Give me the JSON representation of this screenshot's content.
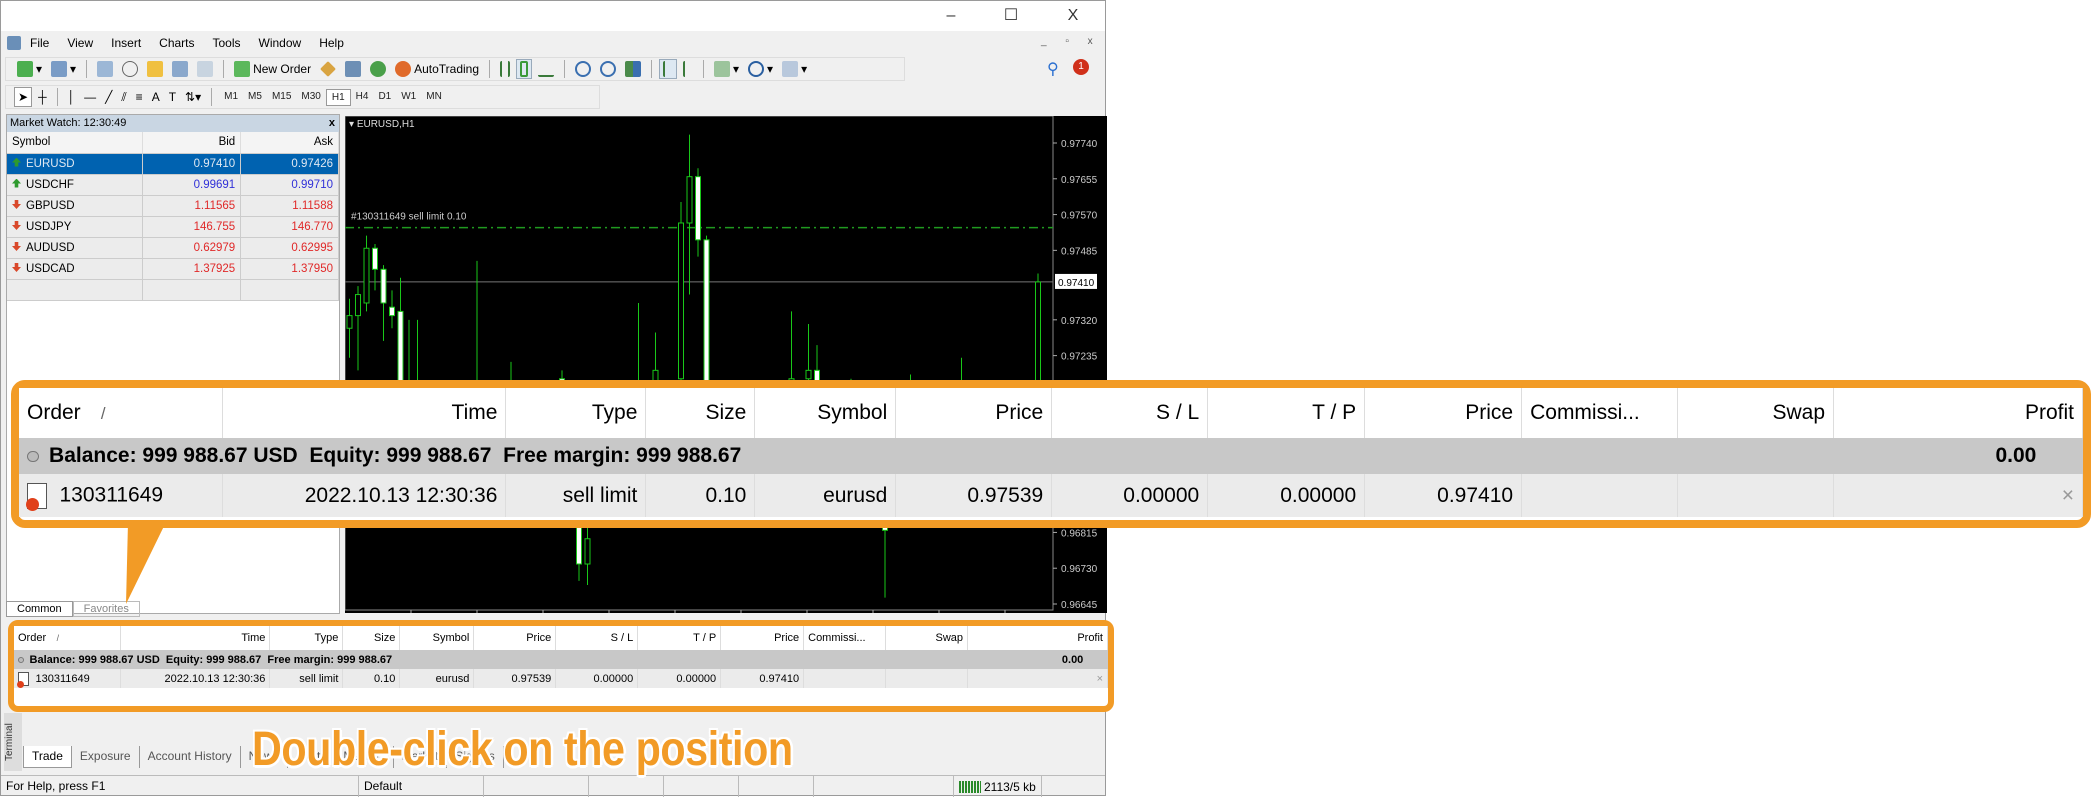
{
  "window": {
    "minimize": "–",
    "maximize": "☐",
    "close": "X"
  },
  "menu": [
    "File",
    "View",
    "Insert",
    "Charts",
    "Tools",
    "Window",
    "Help"
  ],
  "toolbar": {
    "new_order": "New Order",
    "auto_trading": "AutoTrading",
    "notification_count": "1"
  },
  "timeframes": [
    "M1",
    "M5",
    "M15",
    "M30",
    "H1",
    "H4",
    "D1",
    "W1",
    "MN"
  ],
  "active_timeframe": "H1",
  "market_watch": {
    "title": "Market Watch: 12:30:49",
    "close": "x",
    "columns": [
      "Symbol",
      "Bid",
      "Ask"
    ],
    "rows": [
      {
        "symbol": "EURUSD",
        "bid": "0.97410",
        "ask": "0.97426",
        "dir": "up",
        "color": "#dfe8f2",
        "selected": true
      },
      {
        "symbol": "USDCHF",
        "bid": "0.99691",
        "ask": "0.99710",
        "dir": "up",
        "color": "#3030d8"
      },
      {
        "symbol": "GBPUSD",
        "bid": "1.11565",
        "ask": "1.11588",
        "dir": "down",
        "color": "#e02828"
      },
      {
        "symbol": "USDJPY",
        "bid": "146.755",
        "ask": "146.770",
        "dir": "down",
        "color": "#e02828"
      },
      {
        "symbol": "AUDUSD",
        "bid": "0.62979",
        "ask": "0.62995",
        "dir": "down",
        "color": "#e02828"
      },
      {
        "symbol": "USDCAD",
        "bid": "1.37925",
        "ask": "1.37950",
        "dir": "down",
        "color": "#e02828"
      }
    ],
    "tabs": [
      "Common",
      "Favorites"
    ]
  },
  "chart": {
    "title": "EURUSD,H1",
    "order_line_label": "#130311649 sell limit 0.10",
    "order_line_price": 0.97539,
    "bid_price": 0.9741,
    "bid_label": "0.97410",
    "price_ticks": [
      "0.97740",
      "0.97655",
      "0.97570",
      "0.97485",
      "0.97320",
      "0.97235",
      "0.96815",
      "0.96730",
      "0.96645"
    ],
    "price_range": [
      0.96645,
      0.9774
    ],
    "candles": [
      [
        0,
        0.973,
        0.9737,
        0.9723,
        0.9733
      ],
      [
        1,
        0.9733,
        0.974,
        0.972,
        0.9738
      ],
      [
        2,
        0.9736,
        0.9752,
        0.9734,
        0.9749
      ],
      [
        3,
        0.9749,
        0.975,
        0.9739,
        0.9744
      ],
      [
        4,
        0.9744,
        0.9745,
        0.9727,
        0.9736
      ],
      [
        5,
        0.9735,
        0.9739,
        0.973,
        0.9733
      ],
      [
        6,
        0.9734,
        0.9742,
        0.97,
        0.9705
      ],
      [
        7,
        0.9705,
        0.9732,
        0.9695,
        0.97
      ],
      [
        8,
        0.97,
        0.9732,
        0.969,
        0.9696
      ],
      [
        15,
        0.971,
        0.9746,
        0.9705,
        0.9712
      ],
      [
        19,
        0.9715,
        0.9722,
        0.971,
        0.9717
      ],
      [
        25,
        0.9718,
        0.972,
        0.969,
        0.9695
      ],
      [
        27,
        0.9695,
        0.9698,
        0.967,
        0.9674
      ],
      [
        28,
        0.9674,
        0.9688,
        0.9669,
        0.968
      ],
      [
        34,
        0.971,
        0.9736,
        0.97,
        0.9715
      ],
      [
        36,
        0.9715,
        0.9729,
        0.971,
        0.972
      ],
      [
        39,
        0.9718,
        0.976,
        0.971,
        0.9755
      ],
      [
        40,
        0.9755,
        0.9776,
        0.9738,
        0.9766
      ],
      [
        41,
        0.9766,
        0.9768,
        0.9747,
        0.9751
      ],
      [
        42,
        0.9751,
        0.9752,
        0.97,
        0.971
      ],
      [
        52,
        0.9715,
        0.9734,
        0.971,
        0.9718
      ],
      [
        54,
        0.9718,
        0.9731,
        0.9712,
        0.972
      ],
      [
        55,
        0.972,
        0.9726,
        0.971,
        0.9715
      ],
      [
        59,
        0.971,
        0.9718,
        0.9705,
        0.9712
      ],
      [
        63,
        0.969,
        0.9695,
        0.9666,
        0.9682
      ],
      [
        66,
        0.971,
        0.9719,
        0.9705,
        0.9712
      ],
      [
        72,
        0.9715,
        0.9723,
        0.9708,
        0.9716
      ],
      [
        81,
        0.9715,
        0.9743,
        0.971,
        0.9741
      ]
    ]
  },
  "orders": {
    "columns": [
      "Order",
      "Time",
      "Type",
      "Size",
      "Symbol",
      "Price",
      "S / L",
      "T / P",
      "Price",
      "Commissi...",
      "Swap",
      "Profit"
    ],
    "sort_indicator": "/",
    "balance_line": "Balance: 999 988.67 USD  Equity: 999 988.67  Free margin: 999 988.67",
    "balance_profit": "0.00",
    "rows": [
      {
        "order": "130311649",
        "time": "2022.10.13 12:30:36",
        "type": "sell limit",
        "size": "0.10",
        "symbol": "eurusd",
        "price": "0.97539",
        "sl": "0.00000",
        "tp": "0.00000",
        "cur_price": "0.97410",
        "commission": "",
        "swap": "",
        "profit": "",
        "close": "×"
      }
    ]
  },
  "terminal": {
    "label": "Terminal",
    "tabs": [
      "Trade",
      "Exposure",
      "Account History",
      "News",
      "Alerts",
      "Mailbox",
      "Market",
      "Signals"
    ]
  },
  "status": {
    "help": "For Help, press F1",
    "profile": "Default",
    "traffic": "2113/5 kb"
  },
  "annotation": {
    "caption": "Double-click on the position",
    "color": "#f29b26"
  }
}
